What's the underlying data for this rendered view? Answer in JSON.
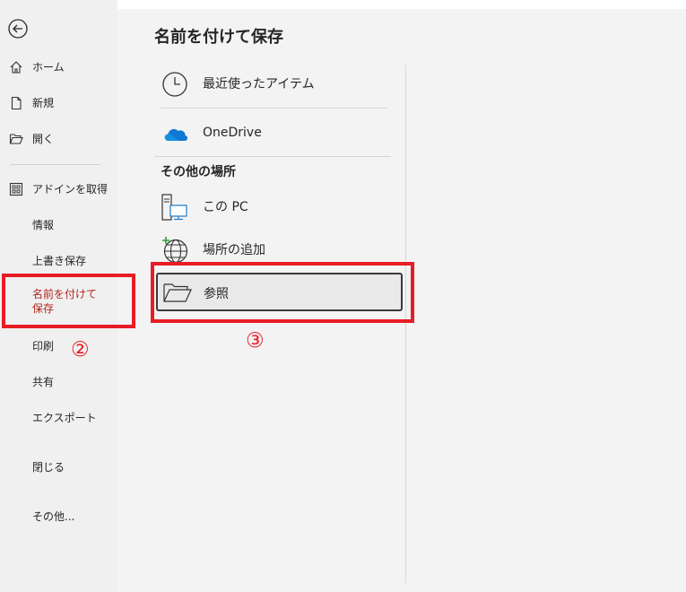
{
  "sidebar": {
    "items": [
      {
        "label": "ホーム",
        "icon": "home-icon"
      },
      {
        "label": "新規",
        "icon": "new-file-icon"
      },
      {
        "label": "開く",
        "icon": "open-folder-icon"
      },
      {
        "label": "アドインを取得",
        "icon": "addins-icon"
      },
      {
        "label": "情報"
      },
      {
        "label": "上書き保存"
      },
      {
        "label": "名前を付けて保存"
      },
      {
        "label": "印刷"
      },
      {
        "label": "共有"
      },
      {
        "label": "エクスポート"
      },
      {
        "label": "閉じる"
      },
      {
        "label": "その他..."
      }
    ],
    "active_index": 6
  },
  "main": {
    "title": "名前を付けて保存",
    "recent": {
      "label": "最近使ったアイテム",
      "icon": "clock-icon"
    },
    "onedrive": {
      "label": "OneDrive",
      "icon": "onedrive-cloud-icon"
    },
    "other_section_title": "その他の場所",
    "this_pc": {
      "label": "この PC",
      "icon": "computer-icon"
    },
    "add_place": {
      "label": "場所の追加",
      "icon": "globe-plus-icon"
    },
    "browse": {
      "label": "参照",
      "icon": "folder-icon"
    }
  },
  "annotations": {
    "step2": "②",
    "step3": "③"
  },
  "colors": {
    "accent_red": "#e81c24",
    "active_text": "#b2251c",
    "onedrive_blue": "#0f78d4"
  }
}
